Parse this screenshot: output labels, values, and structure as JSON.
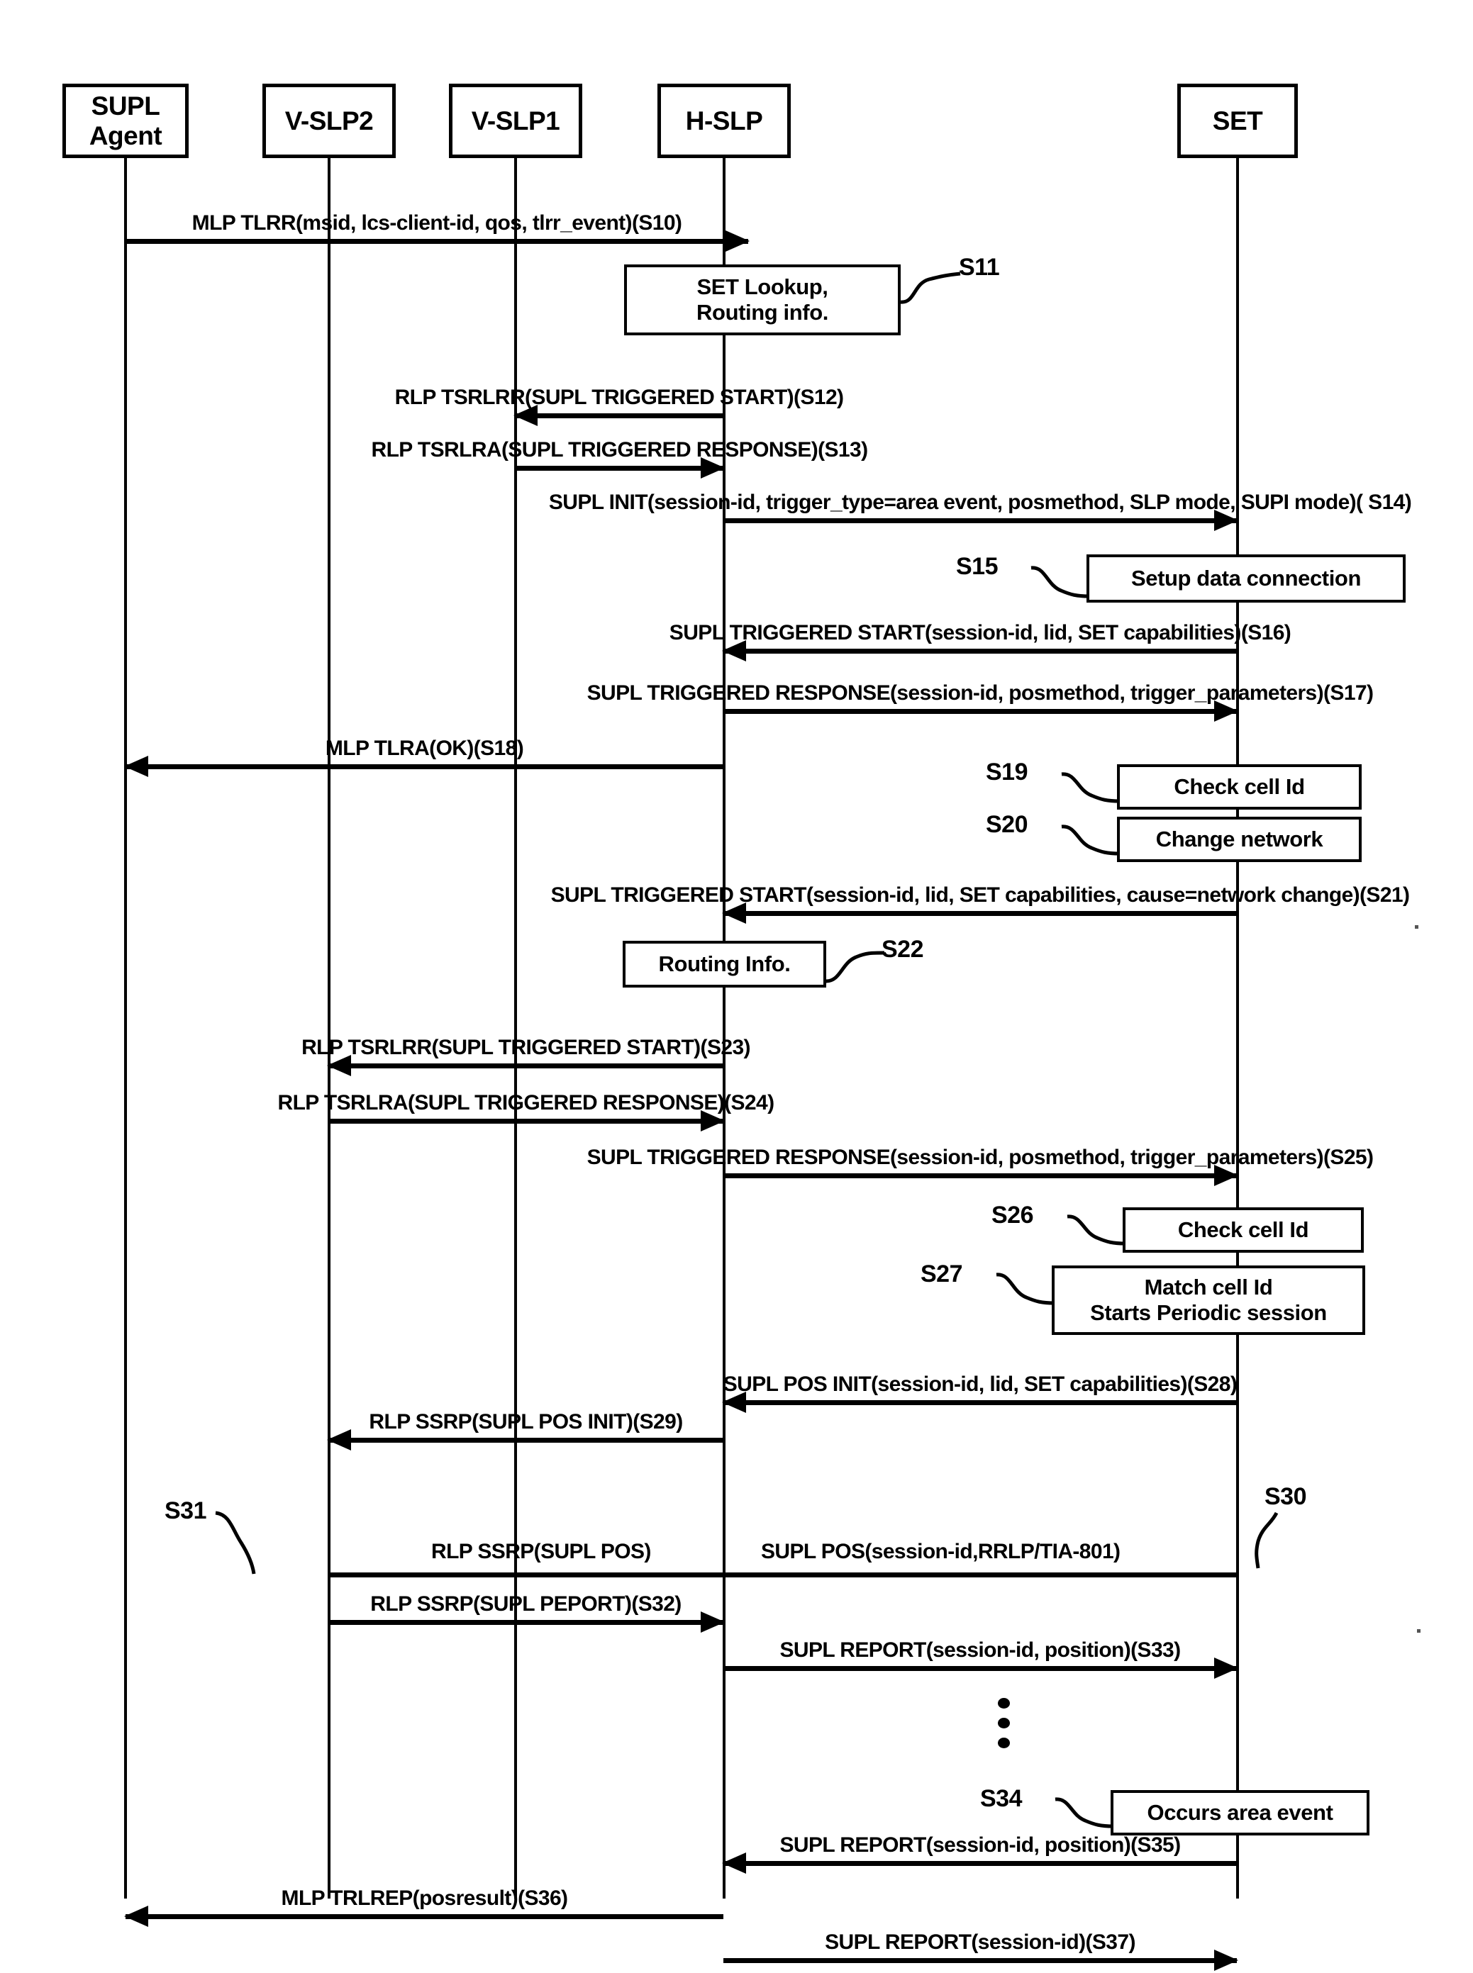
{
  "diagram": {
    "title": "SUPL triggered area event session flow",
    "actors": [
      {
        "id": "agent",
        "label": "SUPL\nAgent",
        "label_line1": "SUPL",
        "label_line2": "Agent"
      },
      {
        "id": "vslp2",
        "label": "V-SLP2"
      },
      {
        "id": "vslp1",
        "label": "V-SLP1"
      },
      {
        "id": "hslp",
        "label": "H-SLP"
      },
      {
        "id": "set",
        "label": "SET"
      }
    ],
    "messages": [
      {
        "step": "S10",
        "text": "MLP TLRR(msid, lcs-client-id, qos, tlrr_event)(S10)",
        "from": "agent",
        "to": "hslp",
        "dir": "right"
      },
      {
        "step": "S12",
        "text": "RLP TSRLRR(SUPL TRIGGERED START)(S12)",
        "from": "hslp",
        "to": "vslp1",
        "dir": "left"
      },
      {
        "step": "S13",
        "text": "RLP TSRLRA(SUPL TRIGGERED RESPONSE)(S13)",
        "from": "vslp1",
        "to": "hslp",
        "dir": "right"
      },
      {
        "step": "S14",
        "text": "SUPL INIT(session-id, trigger_type=area event, posmethod, SLP mode, SUPI mode)( S14)",
        "from": "hslp",
        "to": "set",
        "dir": "right"
      },
      {
        "step": "S16",
        "text": "SUPL TRIGGERED START(session-id, lid, SET capabilities)(S16)",
        "from": "set",
        "to": "hslp",
        "dir": "left"
      },
      {
        "step": "S17",
        "text": "SUPL TRIGGERED RESPONSE(session-id, posmethod, trigger_parameters)(S17)",
        "from": "hslp",
        "to": "set",
        "dir": "right"
      },
      {
        "step": "S18",
        "text": "MLP TLRA(OK)(S18)",
        "from": "hslp",
        "to": "agent",
        "dir": "left"
      },
      {
        "step": "S21",
        "text": "SUPL TRIGGERED START(session-id, lid, SET capabilities, cause=network change)(S21)",
        "from": "set",
        "to": "hslp",
        "dir": "left"
      },
      {
        "step": "S23",
        "text": "RLP TSRLRR(SUPL TRIGGERED START)(S23)",
        "from": "hslp",
        "to": "vslp2",
        "dir": "left"
      },
      {
        "step": "S24",
        "text": "RLP TSRLRA(SUPL TRIGGERED RESPONSE)(S24)",
        "from": "vslp2",
        "to": "hslp",
        "dir": "right"
      },
      {
        "step": "S25",
        "text": "SUPL TRIGGERED RESPONSE(session-id, posmethod, trigger_parameters)(S25)",
        "from": "hslp",
        "to": "set",
        "dir": "right"
      },
      {
        "step": "S28",
        "text": "SUPL POS INIT(session-id, lid, SET capabilities)(S28)",
        "from": "set",
        "to": "hslp",
        "dir": "left"
      },
      {
        "step": "S29",
        "text": "RLP SSRP(SUPL POS INIT)(S29)",
        "from": "hslp",
        "to": "vslp2",
        "dir": "left"
      },
      {
        "step": "S31",
        "text_left": "RLP SSRP(SUPL POS)",
        "text_right": "SUPL POS(session-id,RRLP/TIA-801)",
        "from": "vslp2",
        "to": "set",
        "dir": "none"
      },
      {
        "step": "S32",
        "text": "RLP SSRP(SUPL PEPORT)(S32)",
        "from": "vslp2",
        "to": "hslp",
        "dir": "right"
      },
      {
        "step": "S33",
        "text": "SUPL REPORT(session-id, position)(S33)",
        "from": "hslp",
        "to": "set",
        "dir": "right"
      },
      {
        "step": "S35",
        "text": "SUPL REPORT(session-id, position)(S35)",
        "from": "set",
        "to": "hslp",
        "dir": "left"
      },
      {
        "step": "S36",
        "text": "MLP TRLREP(posresult)(S36)",
        "from": "hslp",
        "to": "agent",
        "dir": "left"
      },
      {
        "step": "S37",
        "text": "SUPL REPORT(session-id)(S37)",
        "from": "hslp",
        "to": "set",
        "dir": "right"
      }
    ],
    "processes": [
      {
        "step": "S11",
        "lines": [
          "SET Lookup,",
          "Routing info."
        ],
        "on": "hslp",
        "tag_side": "right"
      },
      {
        "step": "S15",
        "lines": [
          "Setup data connection"
        ],
        "on": "set",
        "tag_side": "left"
      },
      {
        "step": "S19",
        "lines": [
          "Check cell Id"
        ],
        "on": "set",
        "tag_side": "left"
      },
      {
        "step": "S20",
        "lines": [
          "Change network"
        ],
        "on": "set",
        "tag_side": "left"
      },
      {
        "step": "S22",
        "lines": [
          "Routing Info."
        ],
        "on": "hslp",
        "tag_side": "right"
      },
      {
        "step": "S26",
        "lines": [
          "Check cell Id"
        ],
        "on": "set",
        "tag_side": "left"
      },
      {
        "step": "S27",
        "lines": [
          "Match cell Id",
          "Starts Periodic session"
        ],
        "on": "set",
        "tag_side": "left"
      },
      {
        "step": "S34",
        "lines": [
          "Occurs area event"
        ],
        "on": "set",
        "tag_side": "left"
      }
    ],
    "step_tags": [
      "S11",
      "S15",
      "S19",
      "S20",
      "S22",
      "S26",
      "S27",
      "S30",
      "S31",
      "S34"
    ],
    "standalone_tags": [
      {
        "step": "S30"
      },
      {
        "step": "S31"
      }
    ],
    "ellipsis": {
      "symbol": "vertical-ellipsis",
      "on": "hslp",
      "dots": 3
    }
  }
}
